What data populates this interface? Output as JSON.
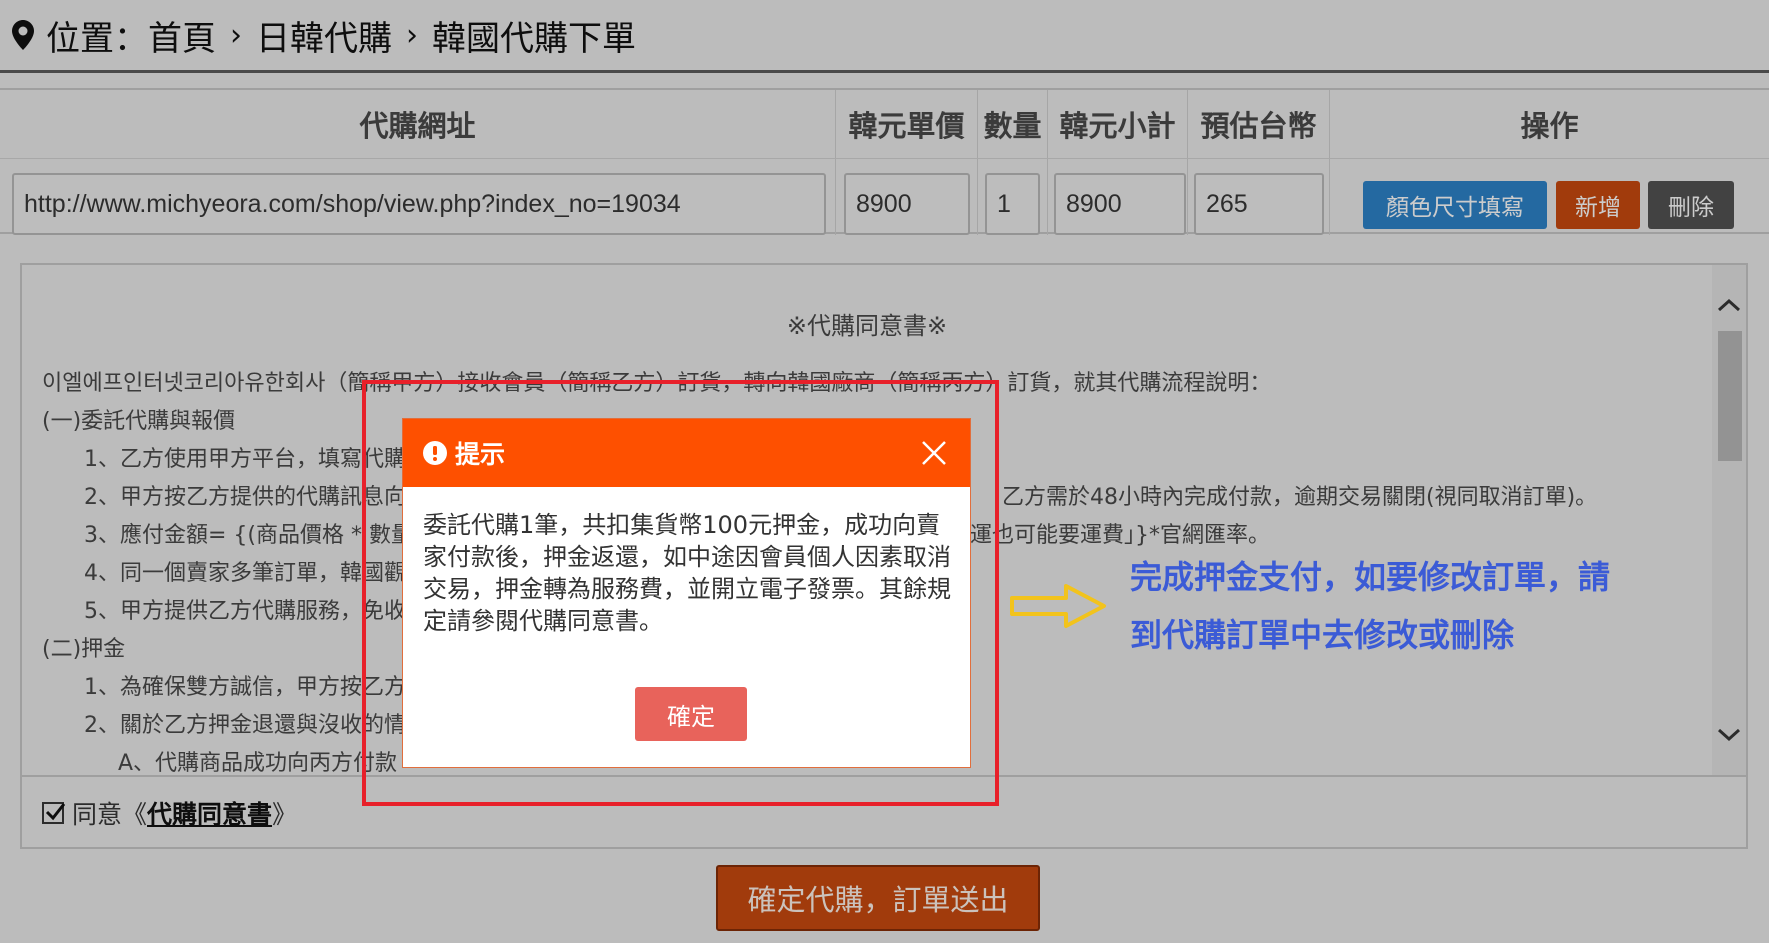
{
  "breadcrumb": {
    "prefix": "位置：首頁",
    "sep": "›",
    "level2": "日韓代購",
    "level3": "韓國代購下單"
  },
  "table": {
    "headers": {
      "url": "代購網址",
      "krw_price": "韓元單價",
      "qty": "數量",
      "krw_subtotal": "韓元小計",
      "twd_estimate": "預估台幣",
      "actions": "操作"
    },
    "row": {
      "url": "http://www.michyeora.com/shop/view.php?index_no=19034",
      "krw_price": "8900",
      "qty": "1",
      "krw_subtotal": "8900",
      "twd_estimate": "265"
    },
    "buttons": {
      "color_size": "顏色尺寸填寫",
      "add": "新增",
      "delete": "刪除"
    }
  },
  "agreement": {
    "title": "※代購同意書※",
    "lines": [
      "이엘에프인터넷코리아유한회사（簡稱甲方）接收會員（簡稱乙方）訂貨，轉向韓國廠商（簡稱丙方）訂貨，就其代購流程說明：",
      "(一)委託代購與報價",
      "1、乙方使用甲方平台，填寫代購",
      "2、甲方按乙方提供的代購訊息向",
      "乙方需於48小時內完成付款，逾期交易關閉(視同取消訂單)。",
      "3、應付金額= {(商品價格 * 數量",
      "運也可能要運費」}*官網匯率。",
      "4、同一個賣家多筆訂單，韓國觀",
      "5、甲方提供乙方代購服務，免收",
      "(二)押金",
      "1、為確保雙方誠信，甲方按乙方",
      "2、關於乙方押金退還與沒收的情",
      "A、代購商品成功向丙方付款"
    ],
    "agree_prefix": "同意《",
    "agree_link": "代購同意書",
    "agree_suffix": "》"
  },
  "submit_label": "確定代購，訂單送出",
  "dialog": {
    "title": "提示",
    "body": "委託代購1筆，共扣集貨幣100元押金，成功向賣家付款後，押金返還，如中途因會員個人因素取消交易，押金轉為服務費，並開立電子發票。其餘規定請參閱代購同意書。",
    "ok_label": "確定"
  },
  "annotation": {
    "line1": "完成押金支付，如要修改訂單，請",
    "line2": "到代購訂單中去修改或刪除"
  },
  "colors": {
    "dialog_header": "#fe5000",
    "ok_button": "#e8635b",
    "highlight_frame": "#e8202a",
    "annotation_text": "#3b5bd6",
    "arrow": "#f2c31c"
  }
}
